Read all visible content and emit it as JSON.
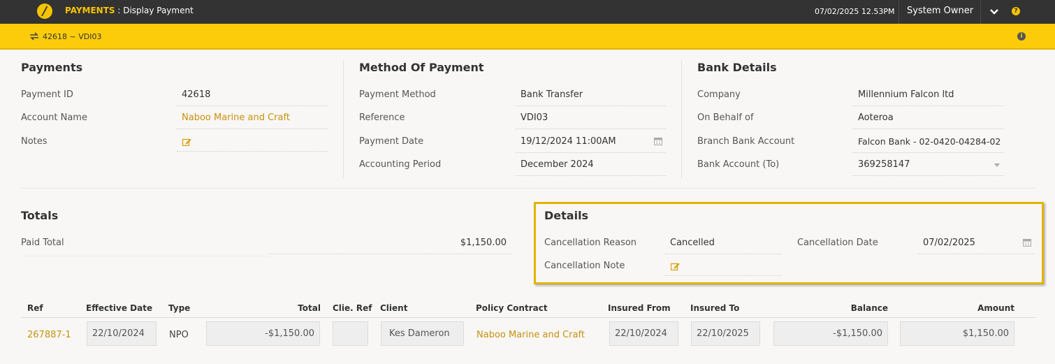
{
  "header": {
    "module": "PAYMENTS",
    "separator": " : ",
    "screen": "Display Payment",
    "datetime": "07/02/2025 12.53PM",
    "user": "System Owner",
    "help_glyph": "?"
  },
  "subheader": {
    "record": "42618 ~ VDI03",
    "info_glyph": "i"
  },
  "payments": {
    "title": "Payments",
    "payment_id_label": "Payment ID",
    "payment_id": "42618",
    "account_name_label": "Account Name",
    "account_name": "Naboo Marine and Craft",
    "notes_label": "Notes"
  },
  "method": {
    "title": "Method Of Payment",
    "payment_method_label": "Payment Method",
    "payment_method": "Bank Transfer",
    "reference_label": "Reference",
    "reference": "VDI03",
    "payment_date_label": "Payment Date",
    "payment_date": "19/12/2024 11:00AM",
    "accounting_period_label": "Accounting Period",
    "accounting_period": "December 2024"
  },
  "bank": {
    "title": "Bank Details",
    "company_label": "Company",
    "company": "Millennium Falcon ltd",
    "on_behalf_label": "On Behalf of",
    "on_behalf": "Aoteroa",
    "branch_label": "Branch Bank Account",
    "branch": "Falcon Bank - 02-0420-04284-02",
    "bank_to_label": "Bank Account (To)",
    "bank_to": "369258147"
  },
  "totals": {
    "title": "Totals",
    "paid_total_label": "Paid Total",
    "paid_total": "$1,150.00"
  },
  "details": {
    "title": "Details",
    "cancellation_reason_label": "Cancellation Reason",
    "cancellation_reason": "Cancelled",
    "cancellation_date_label": "Cancellation Date",
    "cancellation_date": "07/02/2025",
    "cancellation_note_label": "Cancellation Note"
  },
  "table": {
    "headers": {
      "ref": "Ref",
      "effective_date": "Effective Date",
      "type": "Type",
      "total": "Total",
      "clie_ref": "Clie. Ref",
      "client": "Client",
      "policy_contract": "Policy Contract",
      "insured_from": "Insured From",
      "insured_to": "Insured To",
      "balance": "Balance",
      "amount": "Amount"
    },
    "rows": [
      {
        "ref": "267887-1",
        "effective_date": "22/10/2024",
        "type": "NPO",
        "total": "-$1,150.00",
        "clie_ref": "",
        "client": "Kes Dameron",
        "policy_contract": "Naboo Marine and Craft",
        "insured_from": "22/10/2024",
        "insured_to": "22/10/2025",
        "balance": "-$1,150.00",
        "amount": "$1,150.00"
      }
    ]
  },
  "icons": {
    "logo": "app-logo-icon",
    "chevron": "chevron-down-icon",
    "help": "help-icon",
    "swap": "swap-icon",
    "info": "info-icon",
    "calendar": "calendar-icon",
    "edit": "edit-icon",
    "caret": "caret-down-icon"
  },
  "colors": {
    "topbar": "#333333",
    "accent_yellow": "#fccc0a",
    "link": "#c9900c",
    "highlight_border": "#e3b400"
  }
}
